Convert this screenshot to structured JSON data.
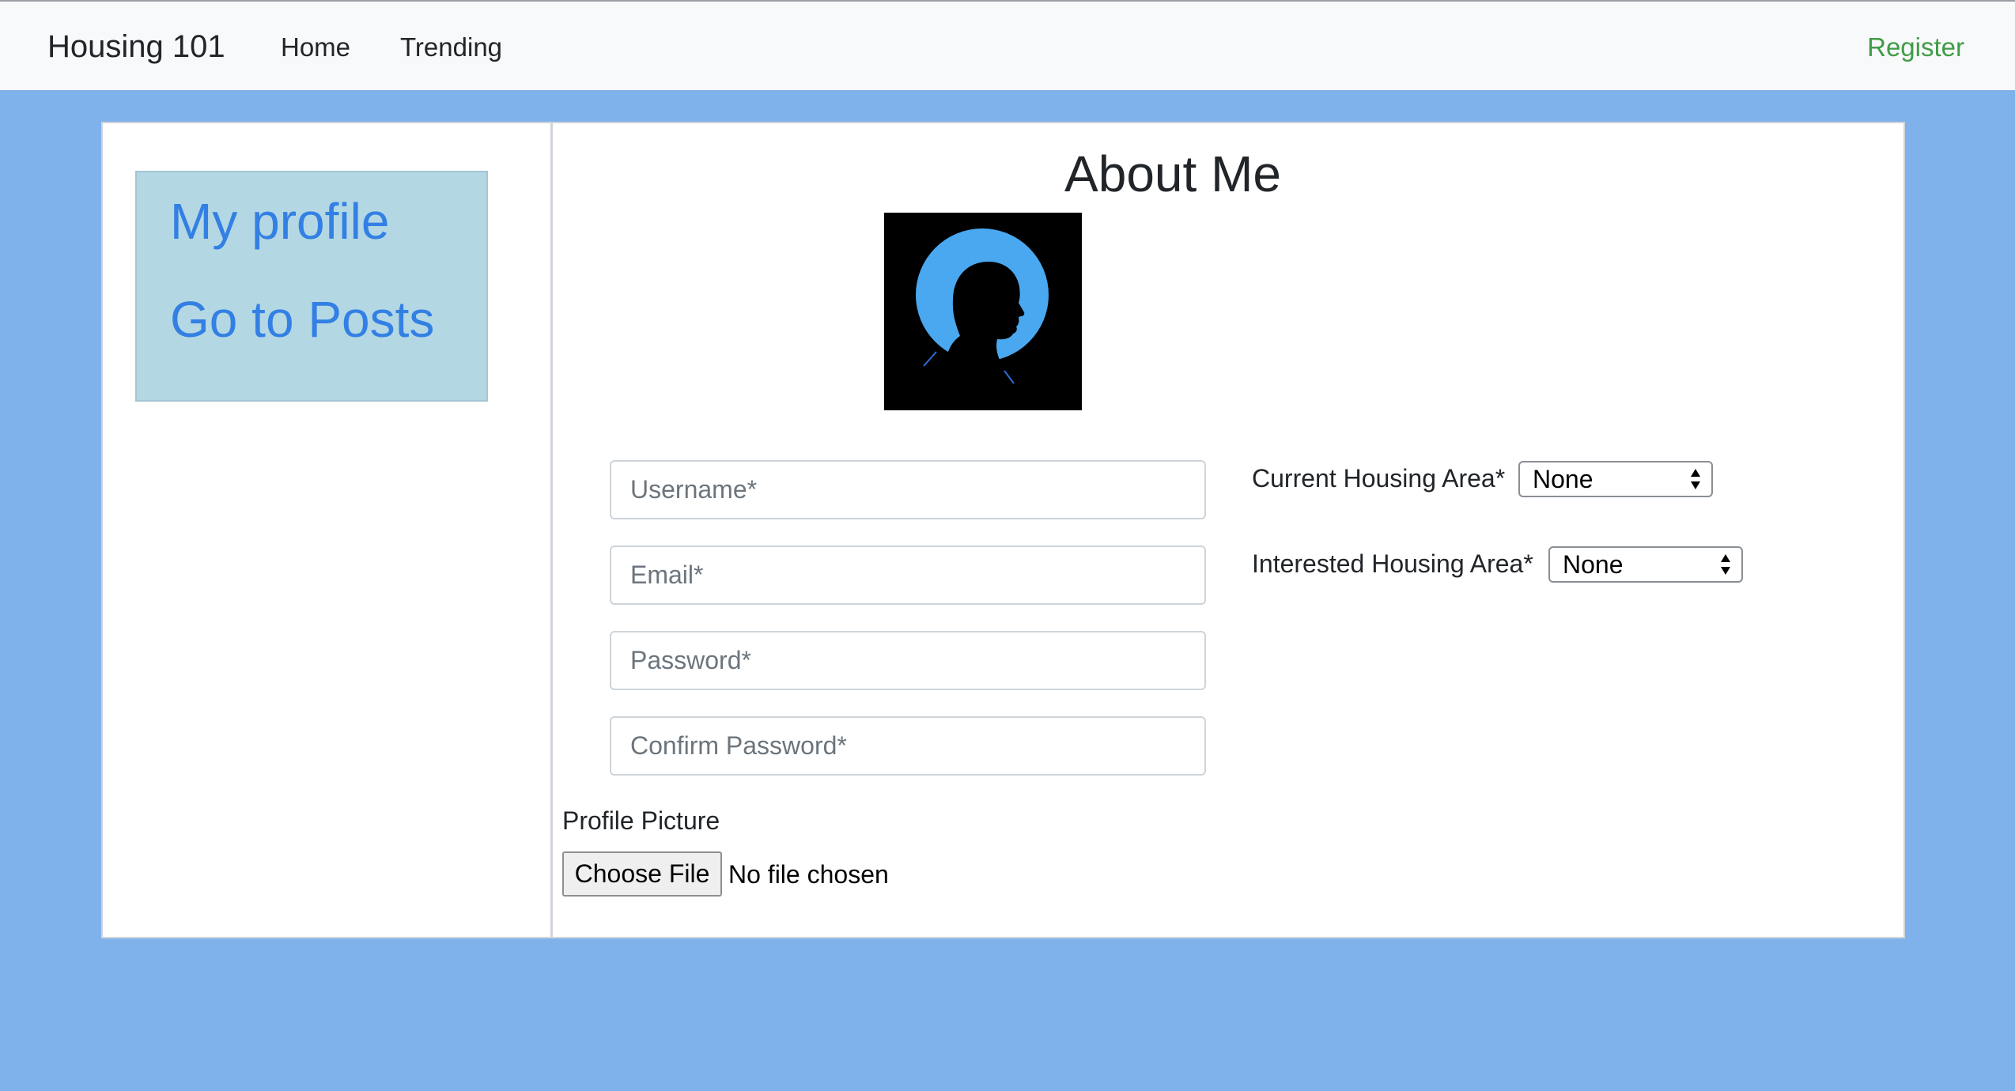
{
  "navbar": {
    "brand": "Housing 101",
    "links": {
      "home": "Home",
      "trending": "Trending",
      "register": "Register"
    },
    "register_color": "#3f9c45"
  },
  "sidebar": {
    "items": [
      {
        "label": "My profile"
      },
      {
        "label": "Go to Posts"
      }
    ],
    "link_color": "#3380e4",
    "menu_background": "#b4d7e4"
  },
  "main": {
    "title": "About Me",
    "avatar_icon": "profile-silhouette-icon",
    "fields": {
      "username": {
        "placeholder": "Username*",
        "value": ""
      },
      "email": {
        "placeholder": "Email*",
        "value": ""
      },
      "password": {
        "placeholder": "Password*",
        "value": ""
      },
      "confirm_password": {
        "placeholder": "Confirm Password*",
        "value": ""
      }
    },
    "current_area": {
      "label": "Current Housing Area*",
      "value": "None"
    },
    "interested_area": {
      "label": "Interested Housing Area*",
      "value": "None"
    },
    "profile_picture": {
      "label": "Profile Picture",
      "button": "Choose File",
      "status": "No file chosen"
    }
  },
  "colors": {
    "page_background": "#7fb2ea",
    "navbar_background": "#f8f9fa"
  }
}
